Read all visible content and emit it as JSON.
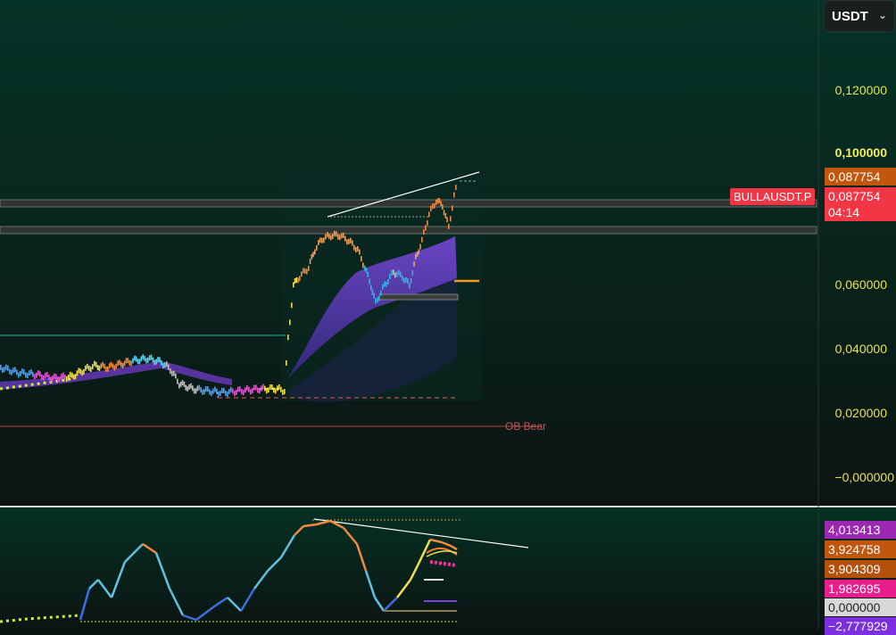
{
  "currency_select": {
    "value": "USDT"
  },
  "symbol_tag": "BULLAUSDT.P",
  "main_scale": {
    "ticks": [
      "0,120000",
      "0,100000",
      "0,060000",
      "0,040000",
      "0,020000",
      "−0,000000"
    ],
    "last_price_badge": "0,087754",
    "price_badge_2": "0,087754",
    "countdown": "04:14"
  },
  "annotations": {
    "ob_label": "OB Bear"
  },
  "oscillator_scale": {
    "badges": [
      {
        "text": "4,013413",
        "color": "#9c27b0"
      },
      {
        "text": "3,924758",
        "color": "#c2560c"
      },
      {
        "text": "3,904309",
        "color": "#b5500b"
      },
      {
        "text": "1,982695",
        "color": "#e91e8c"
      },
      {
        "text": "0,000000",
        "color": "#d8d8d8"
      },
      {
        "text": "−2,777929",
        "color": "#7c2fe0"
      }
    ]
  },
  "colors": {
    "bg_top": "#063327",
    "bg_bottom": "#0c1412",
    "accent_purple": "#6a3bbf",
    "price_label": "#f23645",
    "orange_label": "#c2560c",
    "scale_text": "#e7e34e"
  }
}
